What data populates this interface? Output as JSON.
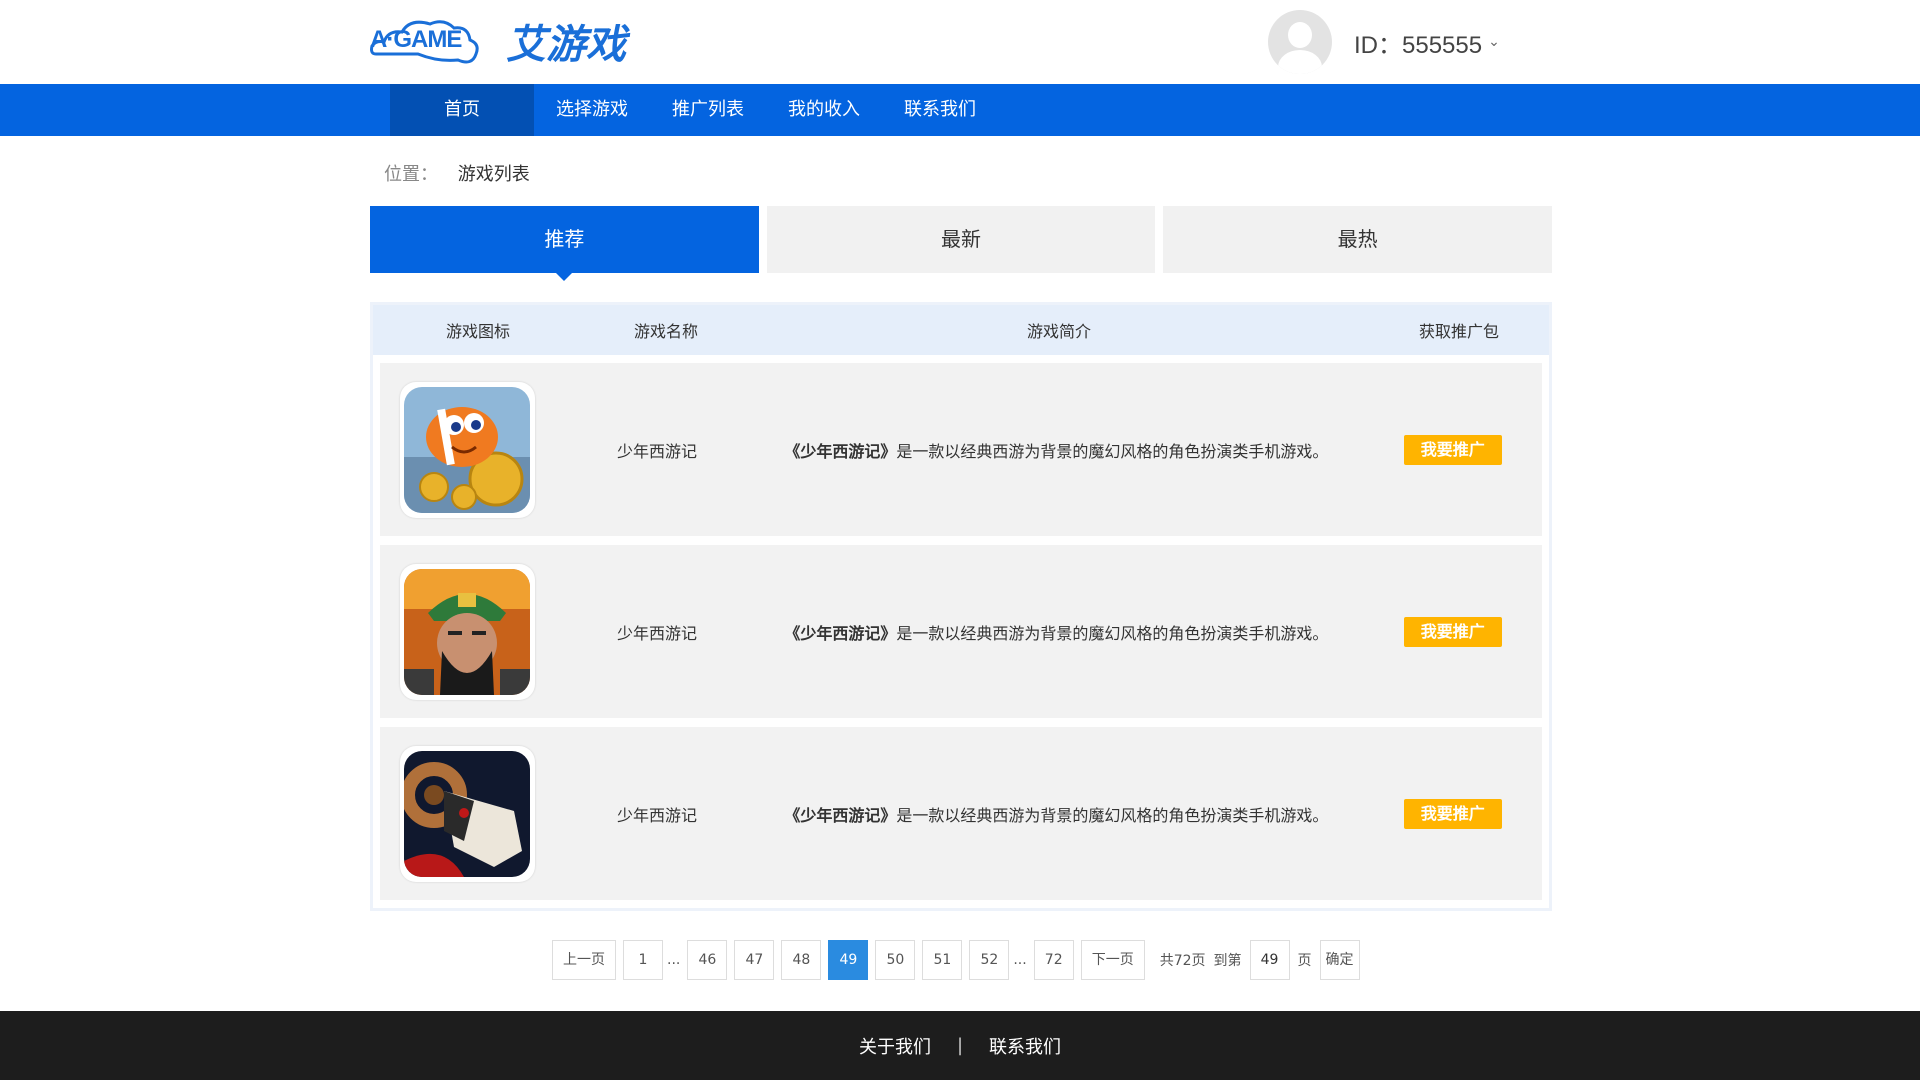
{
  "header": {
    "logo_latin": "A·GAME",
    "logo_cn": "艾游戏",
    "user_id": "ID：555555"
  },
  "nav": {
    "items": [
      {
        "label": "首页"
      },
      {
        "label": "选择游戏"
      },
      {
        "label": "推广列表"
      },
      {
        "label": "我的收入"
      },
      {
        "label": "联系我们"
      }
    ],
    "active_index": 0
  },
  "breadcrumb": {
    "label": "位置：",
    "value": "游戏列表"
  },
  "tabs": [
    {
      "label": "推荐"
    },
    {
      "label": "最新"
    },
    {
      "label": "最热"
    }
  ],
  "table": {
    "headers": [
      "游戏图标",
      "游戏名称",
      "游戏简介",
      "获取推广包"
    ],
    "rows": [
      {
        "icon": "clownfish-game-icon",
        "name": "少年西游记",
        "desc_title": "《少年西游记》",
        "desc_rest": "是一款以经典西游为背景的魔幻风格的角色扮演类手机游戏。",
        "button": "我要推广"
      },
      {
        "icon": "warrior-game-icon",
        "name": "少年西游记",
        "desc_title": "《少年西游记》",
        "desc_rest": "是一款以经典西游为背景的魔幻风格的角色扮演类手机游戏。",
        "button": "我要推广"
      },
      {
        "icon": "ram-game-icon",
        "name": "少年西游记",
        "desc_title": "《少年西游记》",
        "desc_rest": "是一款以经典西游为背景的魔幻风格的角色扮演类手机游戏。",
        "button": "我要推广"
      }
    ]
  },
  "pagination": {
    "prev": "上一页",
    "pages": [
      "1",
      "46",
      "47",
      "48",
      "49",
      "50",
      "51",
      "52",
      "72"
    ],
    "current": "49",
    "dots": "...",
    "next": "下一页",
    "total": "共72页",
    "goto_label": "到第",
    "goto_value": "49",
    "page_unit": "页",
    "confirm": "确定"
  },
  "footer": {
    "about": "关于我们",
    "separator": "|",
    "contact": "联系我们"
  },
  "colors": {
    "primary": "#0464e0",
    "nav_active": "#0350b3",
    "promo_button": "#ffb400",
    "current_page": "#2a8be0",
    "footer_bg": "#1d1d1d"
  }
}
